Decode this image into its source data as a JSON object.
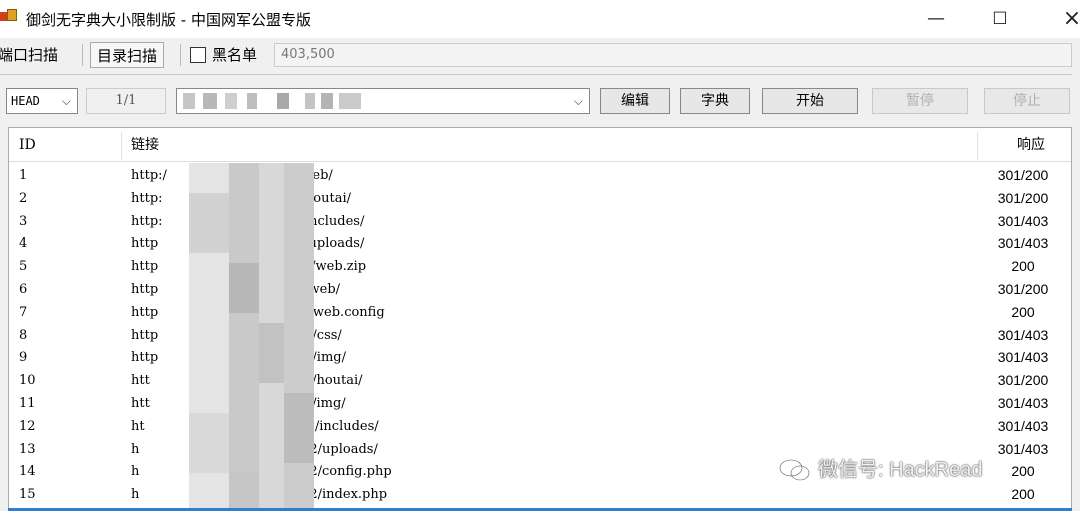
{
  "window": {
    "title": "御剑无字典大小限制版 - 中国网军公盟专版",
    "minimize": "—",
    "maximize": "☐",
    "close": "×"
  },
  "tabs": [
    {
      "label": "端口扫描"
    },
    {
      "label": "目录扫描"
    }
  ],
  "blacklist": {
    "label": "黑名单",
    "checked": false,
    "codes": "403,500"
  },
  "toolbar": {
    "method": "HEAD",
    "counter": "1/1",
    "edit_label": "编辑",
    "dict_label": "字典",
    "start_label": "开始",
    "pause_label": "暂停",
    "stop_label": "停止"
  },
  "table": {
    "headers": {
      "id": "ID",
      "url": "链接",
      "resp": "响应"
    },
    "rows": [
      {
        "id": "1",
        "url_start": "http:/",
        "url_end": "/web/",
        "resp": "301/200"
      },
      {
        "id": "2",
        "url_start": "http:",
        "url_end": "/houtai/",
        "resp": "301/200"
      },
      {
        "id": "3",
        "url_start": "http:",
        "url_end": "/includes/",
        "resp": "301/403"
      },
      {
        "id": "4",
        "url_start": "http",
        "url_end": "/uploads/",
        "resp": "301/403"
      },
      {
        "id": "5",
        "url_start": "http",
        "url_end": "?/web.zip",
        "resp": "200"
      },
      {
        "id": "6",
        "url_start": "http",
        "url_end": "/web/",
        "resp": "301/200"
      },
      {
        "id": "7",
        "url_start": "http",
        "url_end": ":/web.config",
        "resp": "200"
      },
      {
        "id": "8",
        "url_start": "http",
        "url_end": "2/css/",
        "resp": "301/403"
      },
      {
        "id": "9",
        "url_start": "http",
        "url_end": "2/img/",
        "resp": "301/403"
      },
      {
        "id": "10",
        "url_start": "htt",
        "url_end": "2/houtai/",
        "resp": "301/200"
      },
      {
        "id": "11",
        "url_start": "htt",
        "url_end": "2/img/",
        "resp": "301/403"
      },
      {
        "id": "12",
        "url_start": "ht",
        "url_end": "2/includes/",
        "resp": "301/403"
      },
      {
        "id": "13",
        "url_start": "h",
        "url_end": "2/uploads/",
        "resp": "301/403"
      },
      {
        "id": "14",
        "url_start": "h",
        "url_end": "2/config.php",
        "resp": "200"
      },
      {
        "id": "15",
        "url_start": "h",
        "url_end": "2/index.php",
        "resp": "200"
      }
    ]
  },
  "watermark": {
    "text": "微信号: HackRead"
  },
  "icons": {
    "app": "app-icon",
    "method_dropdown": "chevron-down-icon",
    "url_dropdown": "chevron-down-icon",
    "watermark": "wechat-icon"
  }
}
